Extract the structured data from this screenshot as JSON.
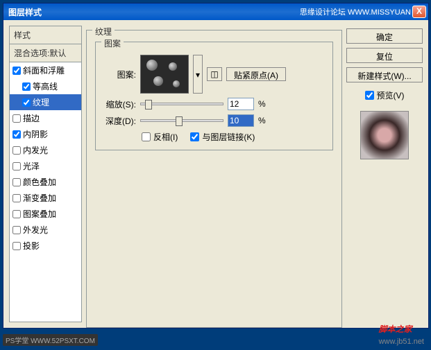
{
  "titlebar": {
    "title": "图层样式",
    "brand": "思缘设计论坛 WWW.MISSYUAN",
    "close": "X"
  },
  "styles": {
    "header": "样式",
    "blend": "混合选项:默认",
    "items": [
      {
        "label": "斜面和浮雕",
        "checked": true,
        "indent": false,
        "selected": false
      },
      {
        "label": "等高线",
        "checked": true,
        "indent": true,
        "selected": false
      },
      {
        "label": "纹理",
        "checked": true,
        "indent": true,
        "selected": true
      },
      {
        "label": "描边",
        "checked": false,
        "indent": false,
        "selected": false
      },
      {
        "label": "内阴影",
        "checked": true,
        "indent": false,
        "selected": false
      },
      {
        "label": "内发光",
        "checked": false,
        "indent": false,
        "selected": false
      },
      {
        "label": "光泽",
        "checked": false,
        "indent": false,
        "selected": false
      },
      {
        "label": "颜色叠加",
        "checked": false,
        "indent": false,
        "selected": false
      },
      {
        "label": "渐变叠加",
        "checked": false,
        "indent": false,
        "selected": false
      },
      {
        "label": "图案叠加",
        "checked": false,
        "indent": false,
        "selected": false
      },
      {
        "label": "外发光",
        "checked": false,
        "indent": false,
        "selected": false
      },
      {
        "label": "投影",
        "checked": false,
        "indent": false,
        "selected": false
      }
    ]
  },
  "main": {
    "group_title": "纹理",
    "sub_title": "图案",
    "pattern_label": "图案:",
    "snap_btn": "贴紧原点(A)",
    "scale_label": "缩放(S):",
    "scale_value": "12",
    "depth_label": "深度(D):",
    "depth_value": "10",
    "pct": "%",
    "invert": "反相(I)",
    "link": "与图层链接(K)"
  },
  "right": {
    "ok": "确定",
    "reset": "复位",
    "new_style": "新建样式(W)...",
    "preview": "预览(V)"
  },
  "watermark": {
    "main": "脚本之家",
    "sub": "www.jb51.net"
  },
  "bottom_tag": "PS学堂 WWW.52PSXT.COM"
}
